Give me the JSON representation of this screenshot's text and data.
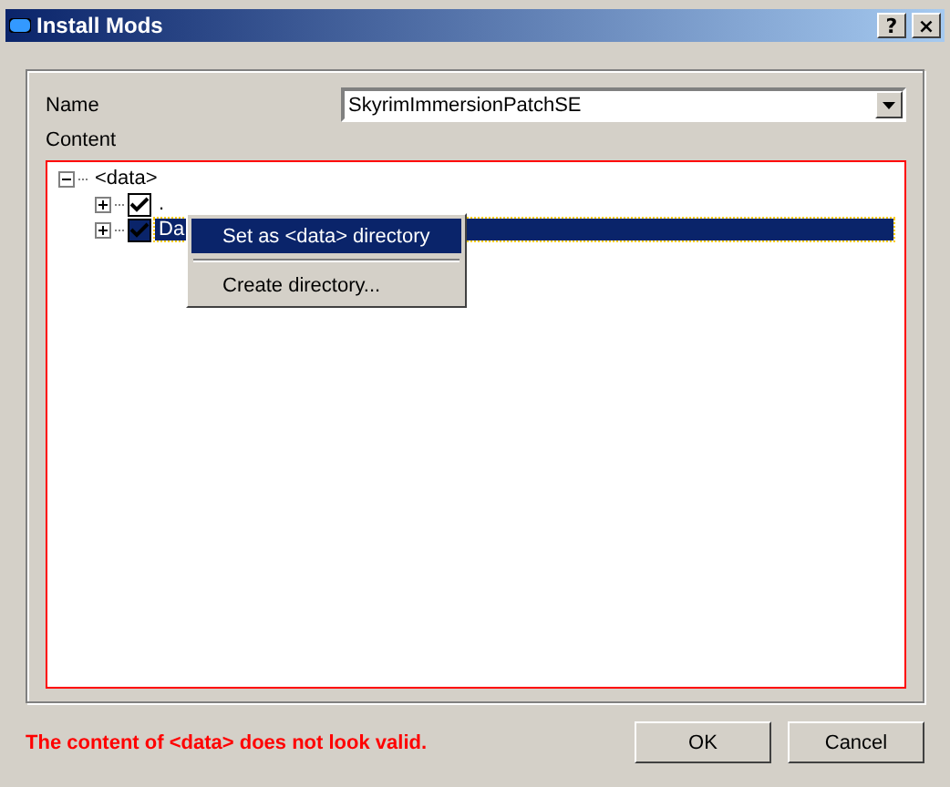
{
  "window": {
    "title": "Install Mods",
    "buttons": [
      "?",
      "×"
    ]
  },
  "name_field": {
    "label": "Name",
    "value": "SkyrimImmersionPatchSE"
  },
  "content": {
    "label": "Content",
    "invalid": true,
    "tree": [
      {
        "label": "<data>",
        "expanded": true,
        "children": [
          {
            "label": ".",
            "checked": true,
            "expanded": false,
            "selected": false
          },
          {
            "label": "Da",
            "checked": true,
            "expanded": false,
            "selected": true
          }
        ]
      }
    ]
  },
  "context_menu": {
    "items": [
      {
        "label": "Set as <data> directory",
        "selected": true
      },
      {
        "label": "Create directory...",
        "selected": false
      }
    ]
  },
  "error": "The content of <data> does not look valid.",
  "buttons": [
    {
      "label": "OK"
    },
    {
      "label": "Cancel"
    }
  ]
}
